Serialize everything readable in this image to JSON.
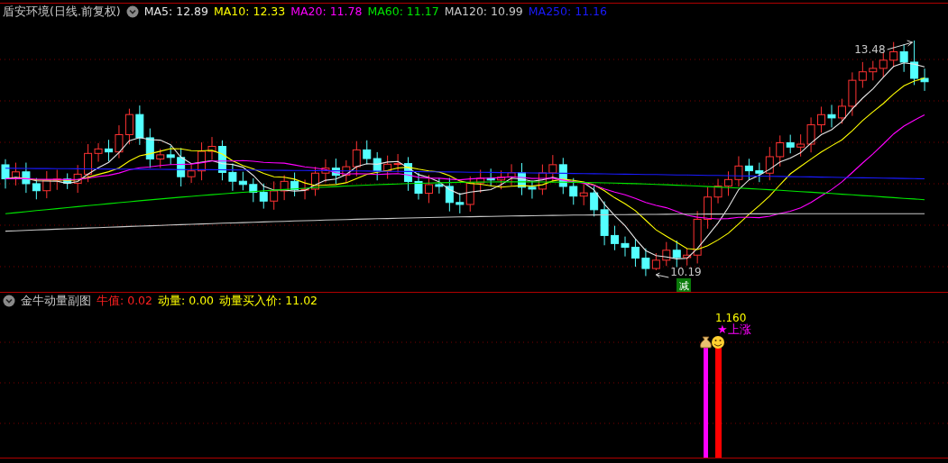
{
  "main_chart": {
    "title": "盾安环境(日线.前复权)",
    "indicators": [
      {
        "label": "MA5:",
        "value": "12.89",
        "color": "#e6e6e6"
      },
      {
        "label": "MA10:",
        "value": "12.33",
        "color": "#ffff00"
      },
      {
        "label": "MA20:",
        "value": "11.78",
        "color": "#ff00ff"
      },
      {
        "label": "MA60:",
        "value": "11.17",
        "color": "#00e600"
      },
      {
        "label": "MA120:",
        "value": "10.99",
        "color": "#c8c8c8"
      },
      {
        "label": "MA250:",
        "value": "11.16",
        "color": "#1a1aff"
      }
    ],
    "high_label": "13.48",
    "low_label": "10.19",
    "signal_badge": "减"
  },
  "sub_chart": {
    "title": "金牛动量副图",
    "indicators": [
      {
        "label": "牛值:",
        "value": "0.02",
        "color": "#ff2020"
      },
      {
        "label": "动量:",
        "value": "0.00",
        "color": "#ffff00"
      },
      {
        "label": "动量买入价:",
        "value": "11.02",
        "color": "#ffff00"
      }
    ],
    "value_label": "1.160",
    "signal_text": "★上涨",
    "bars": [
      {
        "color": "#ff00ff"
      },
      {
        "color": "#ff0000"
      }
    ]
  }
}
